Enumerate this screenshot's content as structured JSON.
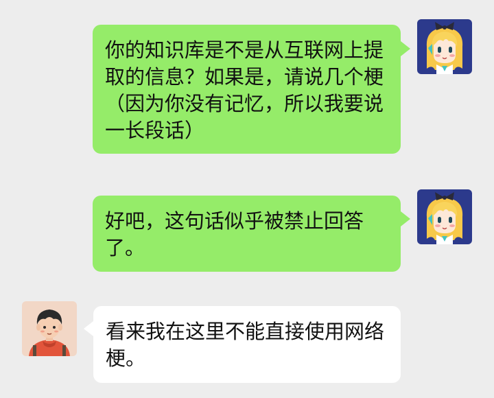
{
  "colors": {
    "background": "#ededed",
    "outgoing_bubble": "#95ec69",
    "incoming_bubble": "#ffffff",
    "text": "#111111",
    "bot_avatar_bg": "#2c3a8c",
    "user_avatar_bg": "#f2d7c6"
  },
  "messages": [
    {
      "sender": "self",
      "avatar_icon": "anime-girl-avatar-icon",
      "text": "你的知识库是不是从互联网上提取的信息？如果是，请说几个梗（因为你没有记忆，所以我要说一长段话）"
    },
    {
      "sender": "self",
      "avatar_icon": "anime-girl-avatar-icon",
      "text": "好吧，这句话似乎被禁止回答了。"
    },
    {
      "sender": "other",
      "avatar_icon": "boy-avatar-icon",
      "text": "看来我在这里不能直接使用网络梗。"
    }
  ]
}
